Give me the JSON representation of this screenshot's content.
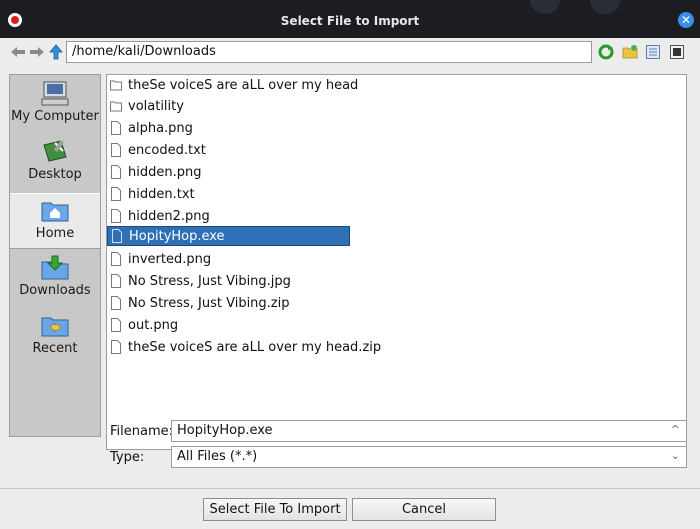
{
  "window": {
    "title": "Select File to Import"
  },
  "pathbar": {
    "path": "/home/kali/Downloads"
  },
  "shortcuts": [
    {
      "label": "My Computer",
      "icon": "computer-icon"
    },
    {
      "label": "Desktop",
      "icon": "desktop-icon"
    },
    {
      "label": "Home",
      "icon": "home-folder-icon"
    },
    {
      "label": "Downloads",
      "icon": "downloads-folder-icon"
    },
    {
      "label": "Recent",
      "icon": "recent-folder-icon"
    }
  ],
  "files": [
    {
      "name": "theSe voiceS are aLL over my head",
      "type": "folder"
    },
    {
      "name": "volatility",
      "type": "folder"
    },
    {
      "name": "alpha.png",
      "type": "file"
    },
    {
      "name": "encoded.txt",
      "type": "file"
    },
    {
      "name": "hidden.png",
      "type": "file"
    },
    {
      "name": "hidden.txt",
      "type": "file"
    },
    {
      "name": "hidden2.png",
      "type": "file"
    },
    {
      "name": "HopityHop.exe",
      "type": "file",
      "selected": true
    },
    {
      "name": "inverted.png",
      "type": "file"
    },
    {
      "name": "No Stress, Just Vibing.jpg",
      "type": "file"
    },
    {
      "name": "No Stress, Just Vibing.zip",
      "type": "file"
    },
    {
      "name": "out.png",
      "type": "file"
    },
    {
      "name": "theSe voiceS are aLL over my head.zip",
      "type": "file"
    }
  ],
  "form": {
    "filename_label": "Filename:",
    "filename_value": "HopityHop.exe",
    "type_label": "Type:",
    "type_value": "All Files (*.*)"
  },
  "buttons": {
    "import": "Select File To Import",
    "cancel": "Cancel"
  },
  "colors": {
    "selection": "#2f6fb5",
    "sidebar": "#c8c8c8"
  }
}
